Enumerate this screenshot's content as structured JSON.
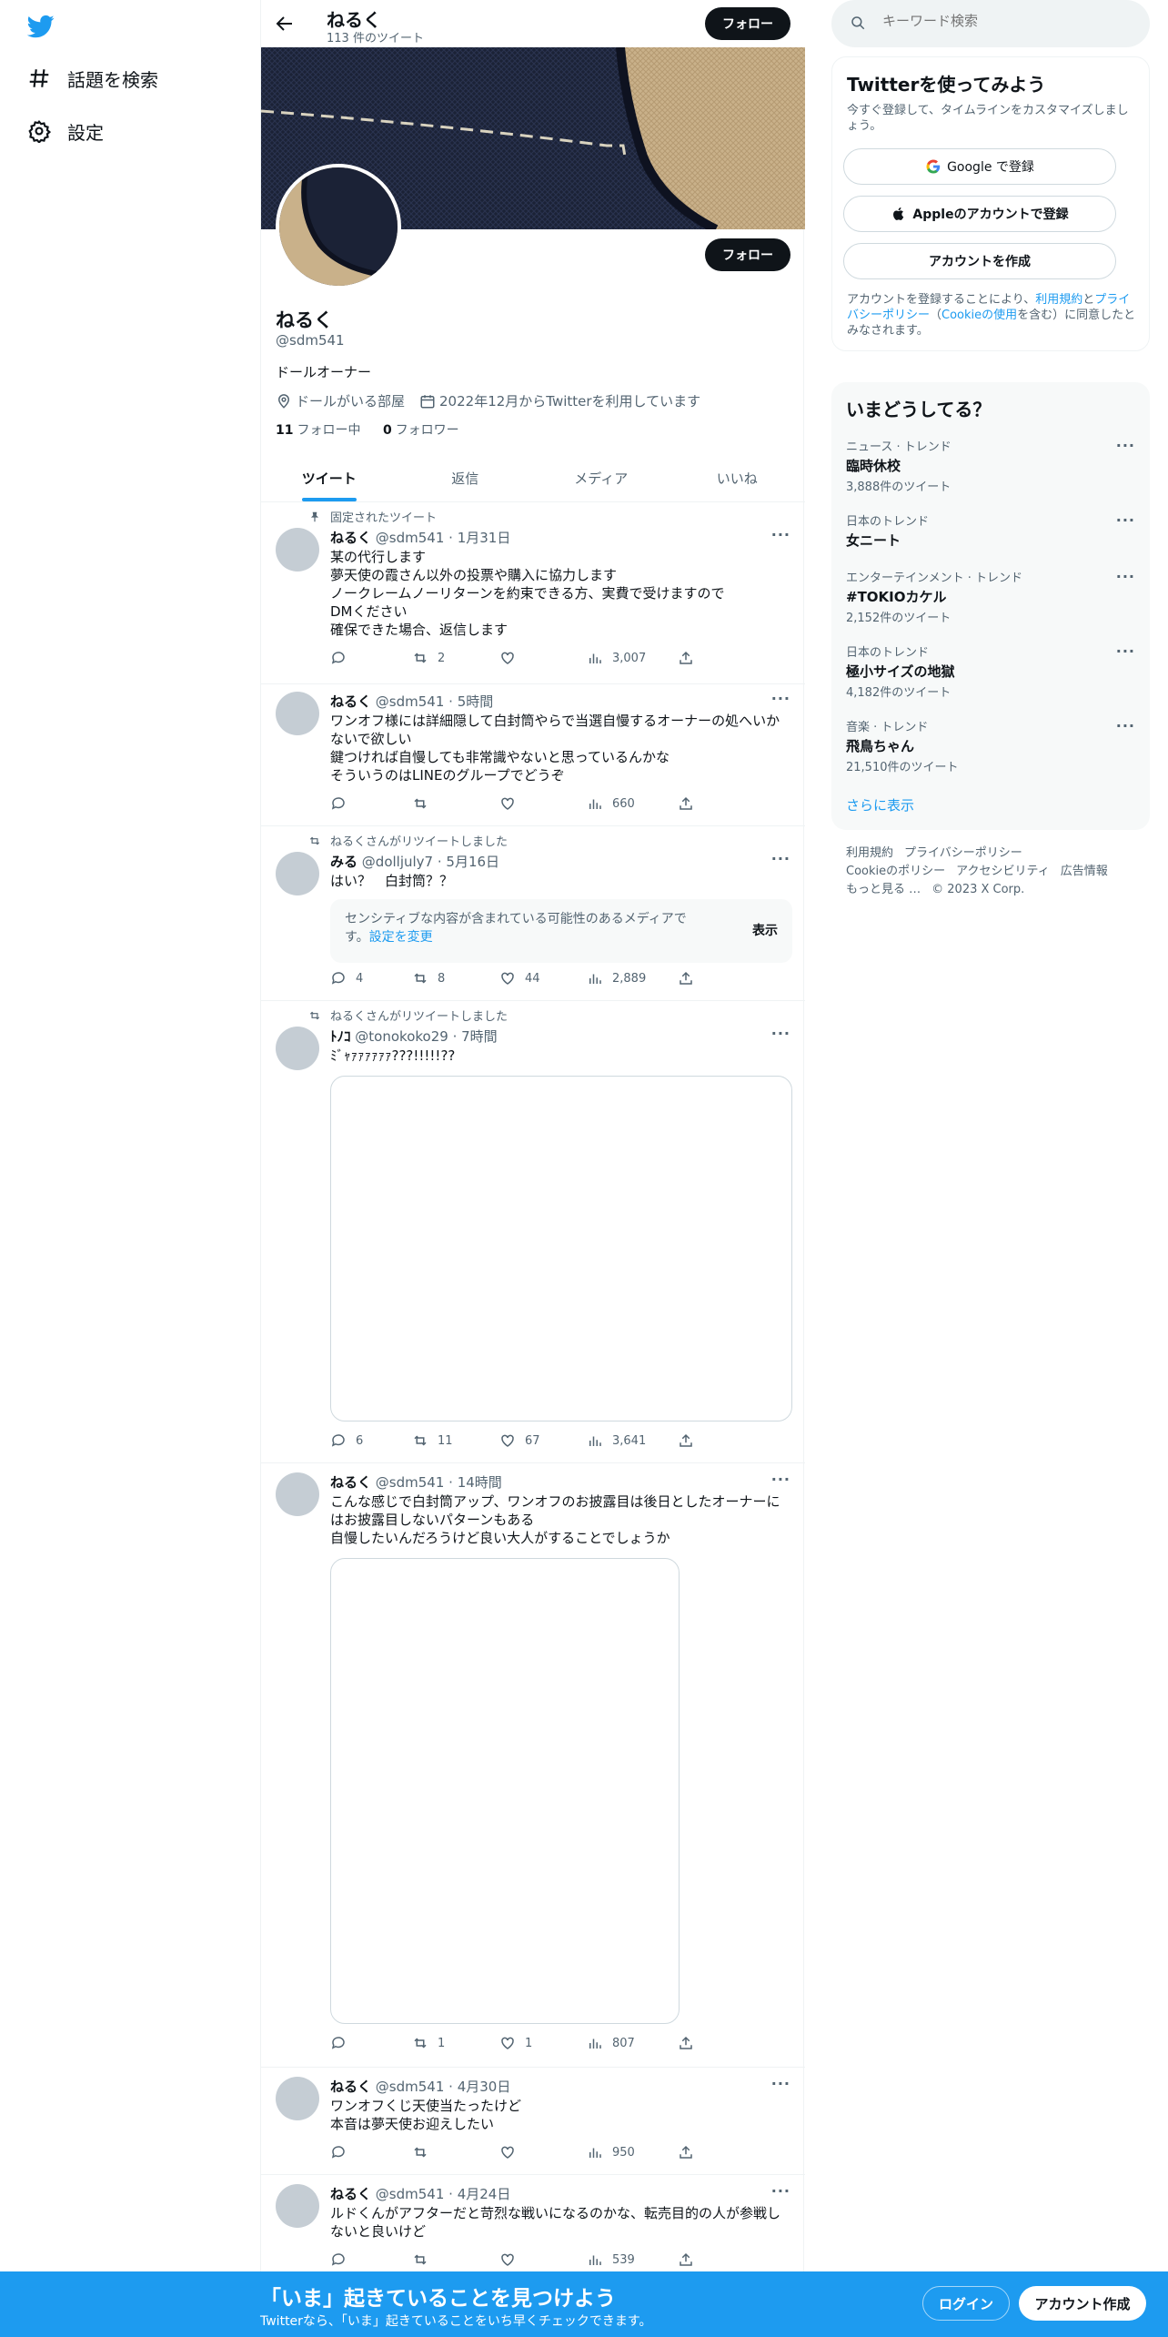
{
  "nav": {
    "items": [
      {
        "label": "話題を検索",
        "icon": "hashtag-icon"
      },
      {
        "label": "設定",
        "icon": "gear-icon"
      }
    ]
  },
  "header": {
    "title": "ねるく",
    "subtitle": "113 件のツイート",
    "follow_label": "フォロー"
  },
  "profile": {
    "name": "ねるく",
    "handle": "@sdm541",
    "bio": "ドールオーナー",
    "location": "ドールがいる部屋",
    "joined": "2022年12月からTwitterを利用しています",
    "following_count": "11",
    "following_label": "フォロー中",
    "followers_count": "0",
    "followers_label": "フォロワー",
    "follow_label": "フォロー"
  },
  "tabs": [
    {
      "label": "ツイート",
      "active": true
    },
    {
      "label": "返信",
      "active": false
    },
    {
      "label": "メディア",
      "active": false
    },
    {
      "label": "いいね",
      "active": false
    }
  ],
  "tweets": [
    {
      "context": "固定されたツイート",
      "name": "ねるく",
      "handle": "@sdm541",
      "time": "· 1月31日",
      "text": "某の代行します\n夢天使の霞さん以外の投票や購入に協力します\nノークレームノーリターンを約束できる方、実費で受けますので\nDMください\n確保できた場合、返信します",
      "replies": "",
      "retweets": "2",
      "likes": "",
      "views": "3,007"
    },
    {
      "context": "",
      "name": "ねるく",
      "handle": "@sdm541",
      "time": "· 5時間",
      "text": "ワンオフ様には詳細隠して白封筒やらで当選自慢するオーナーの処へいかないで欲しい\n鍵つければ自慢しても非常識やないと思っているんかな\nそういうのはLINEのグループでどうぞ",
      "replies": "",
      "retweets": "",
      "likes": "",
      "views": "660"
    },
    {
      "context": "ねるくさんがリツイートしました",
      "name": "みる",
      "handle": "@dolljuly7",
      "time": "· 5月16日",
      "text": "はい？　白封筒？？",
      "sensitive_text": "センシティブな内容が含まれている可能性のあるメディアです。",
      "sensitive_link": "設定を変更",
      "sensitive_show": "表示",
      "replies": "4",
      "retweets": "8",
      "likes": "44",
      "views": "2,889"
    },
    {
      "context": "ねるくさんがリツイートしました",
      "name": "ﾄﾉｺ",
      "handle": "@tonokoko29",
      "time": "· 7時間",
      "text": "ﾐﾞｬｧｧｧｧｧｧ???!!!!!??",
      "replies": "6",
      "retweets": "11",
      "likes": "67",
      "views": "3,641"
    },
    {
      "context": "",
      "name": "ねるく",
      "handle": "@sdm541",
      "time": "· 14時間",
      "text": "こんな感じで白封筒アップ、ワンオフのお披露目は後日としたオーナーにはお披露目しないパターンもある\n自慢したいんだろうけど良い大人がすることでしょうか",
      "replies": "",
      "retweets": "1",
      "likes": "1",
      "views": "807"
    },
    {
      "context": "",
      "name": "ねるく",
      "handle": "@sdm541",
      "time": "· 4月30日",
      "text": "ワンオフくじ天使当たったけど\n本音は夢天使お迎えしたい",
      "replies": "",
      "retweets": "",
      "likes": "",
      "views": "950"
    },
    {
      "context": "",
      "name": "ねるく",
      "handle": "@sdm541",
      "time": "· 4月24日",
      "text": "ルドくんがアフターだと苛烈な戦いになるのかな、転売目的の人が参戦しないと良いけど",
      "replies": "",
      "retweets": "",
      "likes": "",
      "views": "539"
    }
  ],
  "search": {
    "placeholder": "キーワード検索"
  },
  "signup_card": {
    "title": "Twitterを使ってみよう",
    "subtitle": "今すぐ登録して、タイムラインをカスタマイズしましょう。",
    "google_label": "Google で登録",
    "apple_label": "Appleのアカウントで登録",
    "create_label": "アカウントを作成",
    "legal_prefix": "アカウントを登録することにより、",
    "legal_terms": "利用規約",
    "legal_and": "と",
    "legal_privacy": "プライバシーポリシー",
    "legal_paren_open": "（",
    "legal_cookie": "Cookieの使用",
    "legal_suffix": "を含む）に同意したとみなされます。"
  },
  "trends": {
    "title": "いまどうしてる？",
    "items": [
      {
        "category": "ニュース · トレンド",
        "name": "臨時休校",
        "count": "3,888件のツイート"
      },
      {
        "category": "日本のトレンド",
        "name": "女ニート",
        "count": ""
      },
      {
        "category": "エンターテインメント · トレンド",
        "name": "#TOKIOカケル",
        "count": "2,152件のツイート"
      },
      {
        "category": "日本のトレンド",
        "name": "極小サイズの地獄",
        "count": "4,182件のツイート"
      },
      {
        "category": "音楽 · トレンド",
        "name": "飛鳥ちゃん",
        "count": "21,510件のツイート"
      }
    ],
    "show_more": "さらに表示"
  },
  "footer": {
    "terms": "利用規約",
    "privacy": "プライバシーポリシー",
    "cookie": "Cookieのポリシー",
    "accessibility": "アクセシビリティ",
    "ads": "広告情報",
    "more": "もっと見る …",
    "copyright": "© 2023 X Corp."
  },
  "bottom_bar": {
    "title": "「いま」起きていることを見つけよう",
    "subtitle": "Twitterなら、「いま」起きていることをいち早くチェックできます。",
    "login_label": "ログイン",
    "signup_label": "アカウント作成"
  },
  "colors": {
    "accent": "#1d9bf0",
    "text": "#0f1419",
    "muted": "#536471",
    "button_dark": "#0f1419"
  }
}
